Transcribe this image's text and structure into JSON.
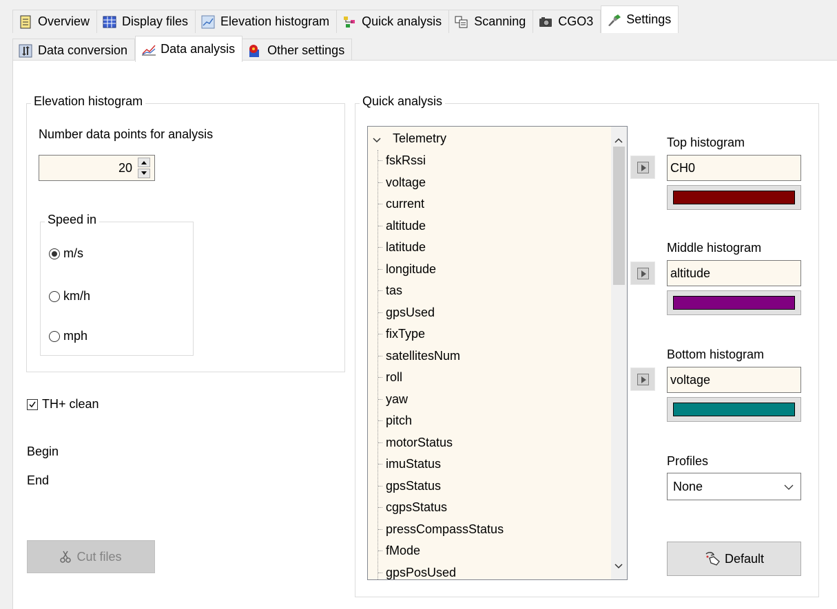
{
  "tabs": [
    {
      "label": "Overview",
      "icon": "overview-icon",
      "active": false
    },
    {
      "label": "Display files",
      "icon": "grid-icon",
      "active": false
    },
    {
      "label": "Elevation histogram",
      "icon": "histogram-icon",
      "active": false
    },
    {
      "label": "Quick analysis",
      "icon": "quick-analysis-icon",
      "active": false
    },
    {
      "label": "Scanning",
      "icon": "scanning-icon",
      "active": false
    },
    {
      "label": "CGO3",
      "icon": "camera-icon",
      "active": false
    },
    {
      "label": "Settings",
      "icon": "settings-icon",
      "active": true
    }
  ],
  "subtabs": [
    {
      "label": "Data conversion",
      "icon": "data-conversion-icon",
      "active": false
    },
    {
      "label": "Data analysis",
      "icon": "data-analysis-icon",
      "active": true
    },
    {
      "label": "Other settings",
      "icon": "other-settings-icon",
      "active": false
    }
  ],
  "elevation": {
    "legend": "Elevation histogram",
    "points_label": "Number data points for analysis",
    "points_value": "20"
  },
  "speed": {
    "legend": "Speed in",
    "options": [
      {
        "label": "m/s",
        "checked": true
      },
      {
        "label": "km/h",
        "checked": false
      },
      {
        "label": "mph",
        "checked": false
      }
    ]
  },
  "th_clean": {
    "label": "TH+ clean",
    "checked": true
  },
  "begin_label": "Begin",
  "end_label": "End",
  "cut_files_label": "Cut files",
  "quick": {
    "legend": "Quick analysis",
    "tree_root": "Telemetry",
    "tree_items": [
      "fskRssi",
      "voltage",
      "current",
      "altitude",
      "latitude",
      "longitude",
      "tas",
      "gpsUsed",
      "fixType",
      "satellitesNum",
      "roll",
      "yaw",
      "pitch",
      "motorStatus",
      "imuStatus",
      "gpsStatus",
      "cgpsStatus",
      "pressCompassStatus",
      "fMode",
      "gpsPosUsed"
    ],
    "top_label": "Top histogram",
    "top_value": "CH0",
    "top_color": "#800000",
    "middle_label": "Middle histogram",
    "middle_value": "altitude",
    "middle_color": "#800080",
    "bottom_label": "Bottom histogram",
    "bottom_value": "voltage",
    "bottom_color": "#008080",
    "profiles_label": "Profiles",
    "profiles_value": "None",
    "default_label": "Default"
  }
}
